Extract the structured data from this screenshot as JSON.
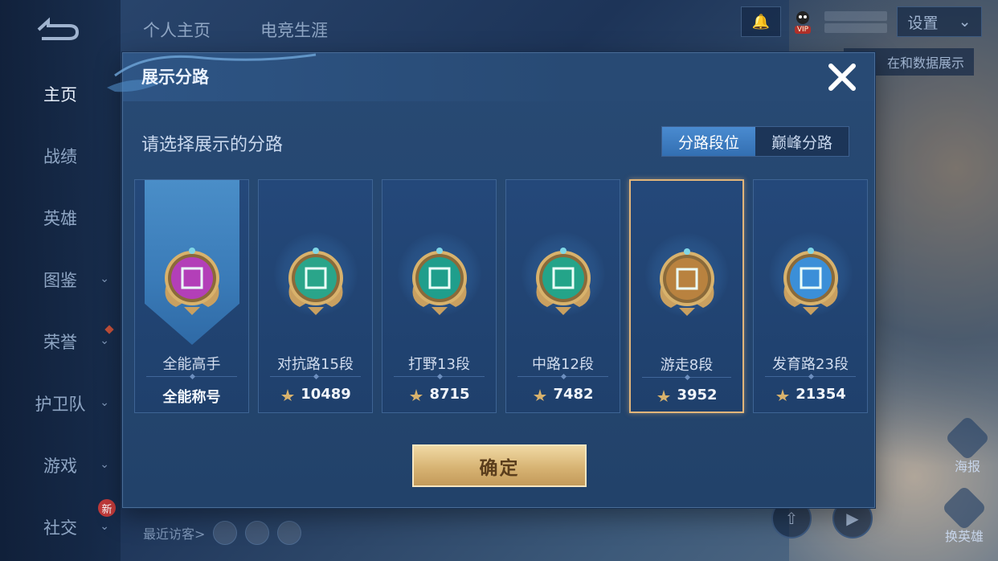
{
  "sidebar": {
    "items": [
      {
        "label": "主页",
        "active": true,
        "chevron": false
      },
      {
        "label": "战绩",
        "active": false,
        "chevron": false
      },
      {
        "label": "英雄",
        "active": false,
        "chevron": false
      },
      {
        "label": "图鉴",
        "active": false,
        "chevron": true
      },
      {
        "label": "荣誉",
        "active": false,
        "chevron": true
      },
      {
        "label": "护卫队",
        "active": false,
        "chevron": true
      },
      {
        "label": "游戏",
        "active": false,
        "chevron": true
      },
      {
        "label": "社交",
        "active": false,
        "chevron": true
      }
    ],
    "new_badge": "新"
  },
  "topbar": {
    "tabs": [
      "个人主页",
      "电竞生涯"
    ],
    "settings_label": "设置",
    "vip_badge": "VIP"
  },
  "background": {
    "tip_text": "在和数据展示",
    "visitors_label": "最近访客>",
    "right_controls": [
      "海报",
      "换英雄"
    ]
  },
  "modal": {
    "title": "展示分路",
    "subtitle": "请选择展示的分路",
    "segment": {
      "options": [
        "分路段位",
        "巅峰分路"
      ],
      "selected": 0
    },
    "cards": [
      {
        "name": "全能高手",
        "score": "全能称号",
        "icon": "all-round-emblem-icon",
        "color": "#b33fb8",
        "selected": false,
        "special": true
      },
      {
        "name": "对抗路15段",
        "score": "10489",
        "icon": "clash-lane-emblem-icon",
        "color": "#2aa58a",
        "selected": false
      },
      {
        "name": "打野13段",
        "score": "8715",
        "icon": "jungle-emblem-icon",
        "color": "#1f9e8c",
        "selected": false
      },
      {
        "name": "中路12段",
        "score": "7482",
        "icon": "mid-lane-emblem-icon",
        "color": "#24a489",
        "selected": false
      },
      {
        "name": "游走8段",
        "score": "3952",
        "icon": "roam-emblem-icon",
        "color": "#b9823f",
        "selected": true
      },
      {
        "name": "发育路23段",
        "score": "21354",
        "icon": "farm-lane-emblem-icon",
        "color": "#3b8fd8",
        "selected": false
      }
    ],
    "confirm_label": "确定"
  },
  "colors": {
    "accent_gold": "#d7b373",
    "selected_border": "#e2b57a",
    "segment_active": "#3f7fc4"
  }
}
